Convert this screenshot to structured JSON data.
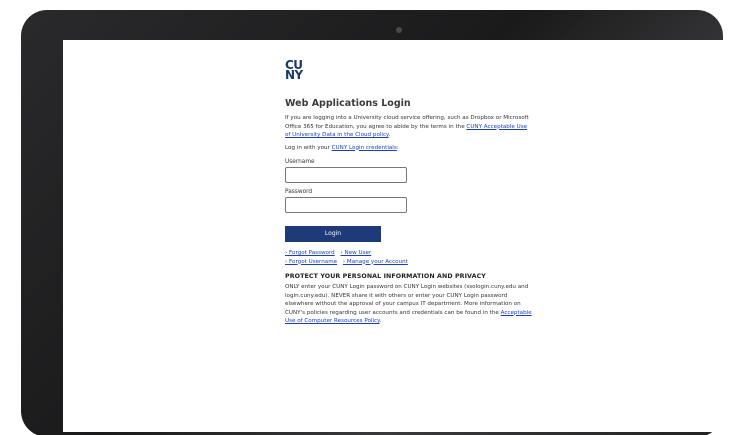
{
  "logo": {
    "line1": "CU",
    "line2": "NY"
  },
  "login": {
    "title": "Web Applications Login",
    "intro_prefix": "If you are logging into a University cloud service offering, such as Dropbox or Microsoft Office 365 for Education, you agree to abide by the terms in the ",
    "intro_link": "CUNY Acceptable Use of University Data in the Cloud policy",
    "intro_suffix": ".",
    "login_with_prefix": "Log in with your ",
    "login_with_link": "CUNY Login credentials",
    "login_with_suffix": ":",
    "username_label": "Username",
    "username_value": "",
    "password_label": "Password",
    "password_value": "",
    "button_label": "Login"
  },
  "links": {
    "forgot_password": "› Forgot Password",
    "new_user": "› New User",
    "forgot_username": "› Forgot Username",
    "manage_account": "› Manage your Account"
  },
  "privacy": {
    "title": "PROTECT YOUR PERSONAL INFORMATION AND PRIVACY",
    "body": "ONLY enter your CUNY Login password on CUNY Login websites (ssologin.cuny.edu and login.cuny.edu). NEVER share it with others or enter your CUNY Login password elsewhere without the approval of your campus IT department. More information on CUNY's policies regarding user accounts and credentials can be found in the ",
    "link": "Acceptable Use of Computer Resources Policy",
    "suffix": "."
  },
  "colors": {
    "brand": "#1d3a6b",
    "button": "#1f3a78",
    "link": "#1a3fb8"
  }
}
